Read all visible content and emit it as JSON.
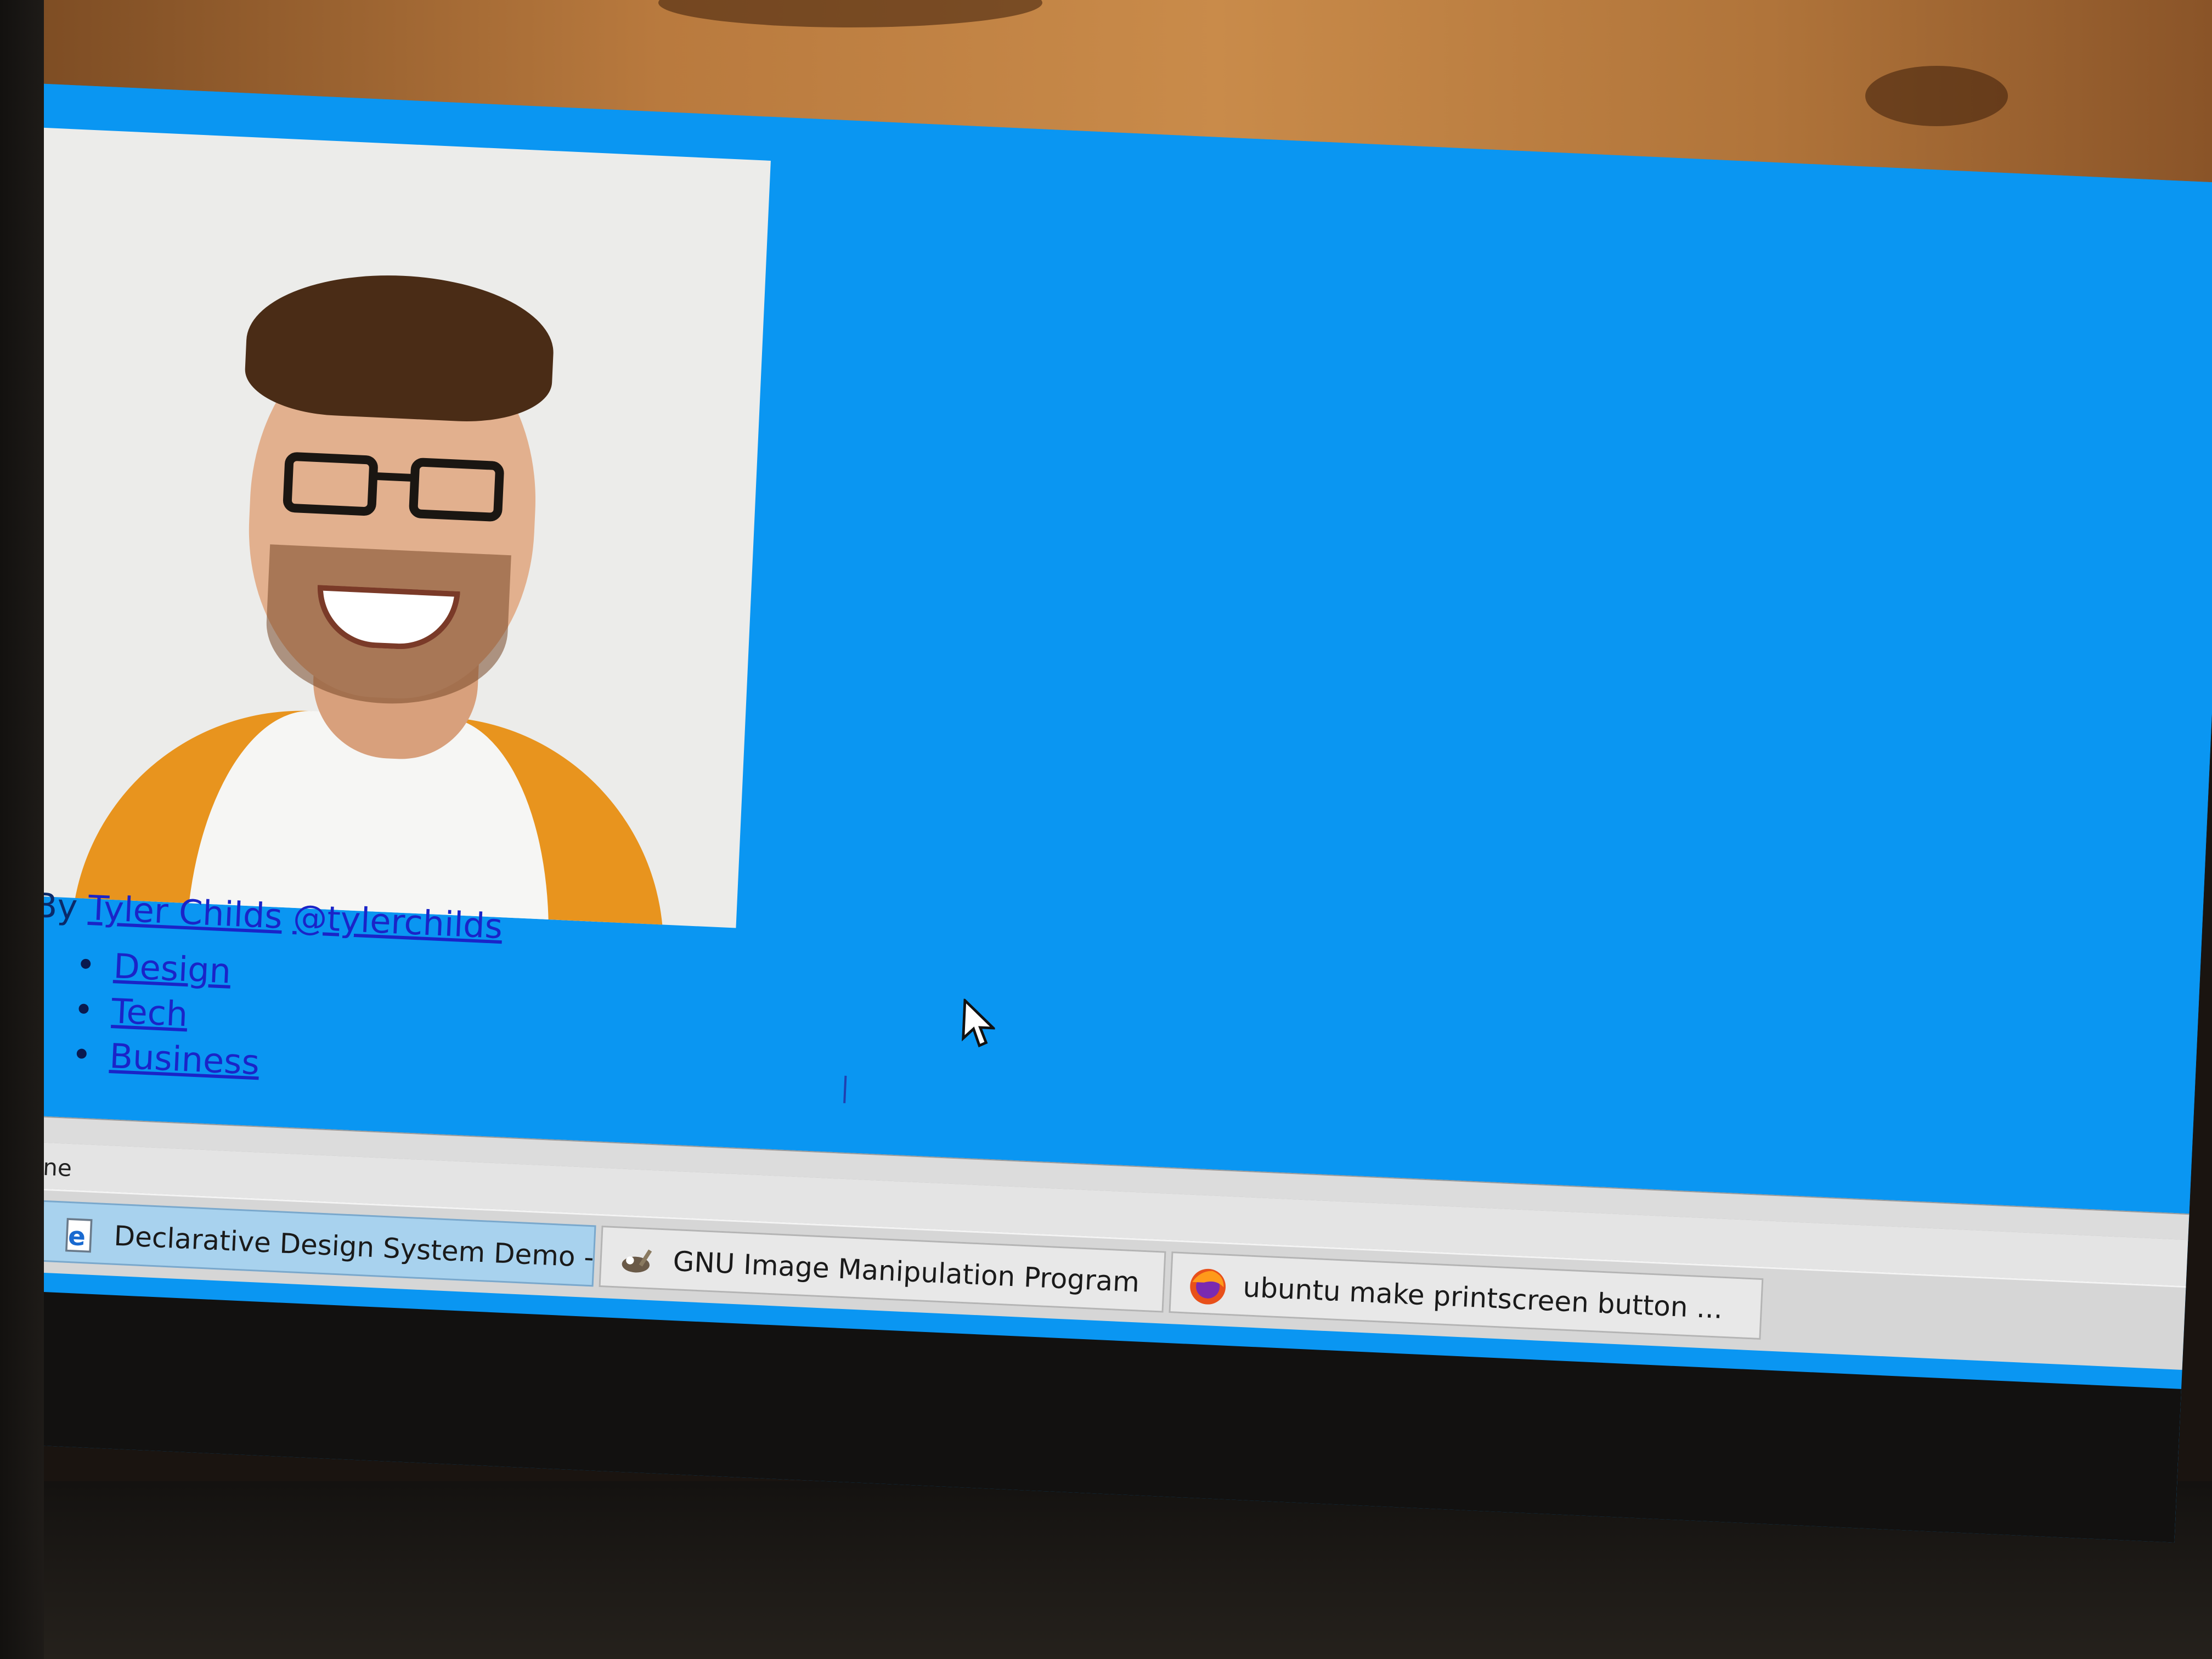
{
  "page": {
    "byline_prefix": "By",
    "author_name": "Tyler Childs",
    "author_handle": "@tylerchilds",
    "nav": [
      {
        "label": "Design"
      },
      {
        "label": "Tech"
      },
      {
        "label": "Business"
      }
    ],
    "background_color": "#0a96f2",
    "link_color": "#1a24c8"
  },
  "statusbar": {
    "status": "Done",
    "icon": "ie-page-icon"
  },
  "taskbar": {
    "start_icon": "start-menu-icon",
    "tasks": [
      {
        "label": "Declarative Design System Demo -...",
        "icon": "internet-explorer-icon",
        "active": true
      },
      {
        "label": "GNU Image Manipulation Program",
        "icon": "gimp-icon",
        "active": false
      },
      {
        "label": "ubuntu make printscreen button ...",
        "icon": "firefox-icon",
        "active": false
      }
    ]
  }
}
